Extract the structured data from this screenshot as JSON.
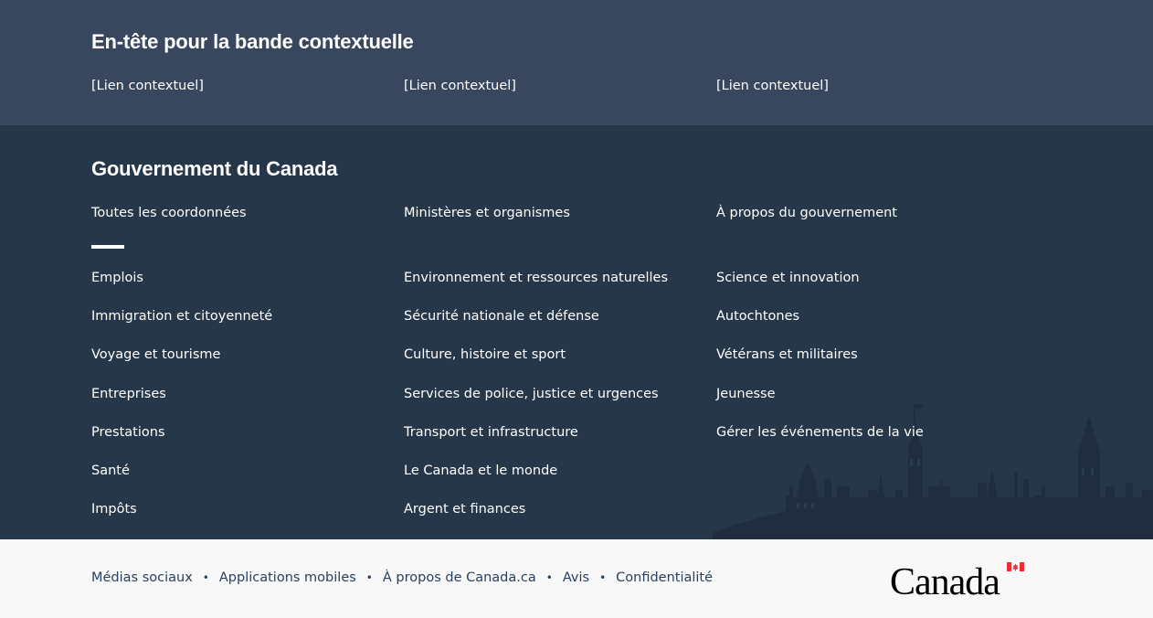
{
  "contextual": {
    "heading": "En-tête pour la bande contextuelle",
    "links": [
      "[Lien contextuel]",
      "[Lien contextuel]",
      "[Lien contextuel]"
    ]
  },
  "gov": {
    "heading": "Gouvernement du Canada",
    "top_links": [
      "Toutes les coordonnées",
      "Ministères et organismes",
      "À propos du gouvernement"
    ],
    "col1": [
      "Emplois",
      "Immigration et citoyenneté",
      "Voyage et tourisme",
      "Entreprises",
      "Prestations",
      "Santé",
      "Impôts"
    ],
    "col2": [
      "Environnement et ressources naturelles",
      "Sécurité nationale et défense",
      "Culture, histoire et sport",
      "Services de police, justice et urgences",
      "Transport et infrastructure",
      "Le Canada et le monde",
      "Argent et finances"
    ],
    "col3": [
      "Science et innovation",
      "Autochtones",
      "Vétérans et militaires",
      "Jeunesse",
      "Gérer les événements de la vie"
    ]
  },
  "footer": {
    "links": [
      "Médias sociaux",
      "Applications mobiles",
      "À propos de Canada.ca",
      "Avis",
      "Confidentialité"
    ],
    "separator": "•",
    "wordmark": "Canada"
  },
  "colors": {
    "contextual_bg": "#38475e",
    "main_bg": "#26374a",
    "footer_bg": "#f8f8f8",
    "footer_link": "#284162",
    "flag_red": "#eb2d37"
  }
}
